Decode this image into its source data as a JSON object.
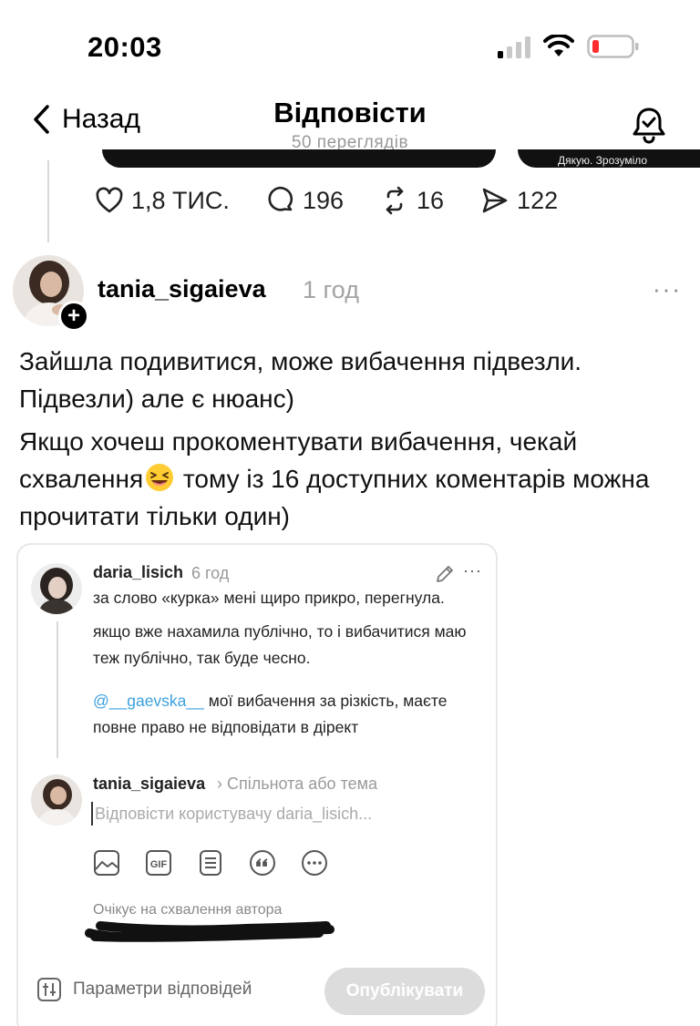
{
  "status_bar": {
    "time": "20:03"
  },
  "header": {
    "back_label": "Назад",
    "title": "Відповісти",
    "subtitle": "50 переглядів"
  },
  "previous_post": {
    "card_caption": "Дякую. Зрозуміло",
    "likes": "1,8 ТИС.",
    "comments": "196",
    "reposts": "16",
    "shares": "122"
  },
  "post": {
    "username": "tania_sigaieva",
    "time": "1 год",
    "more_label": "···",
    "follow_label": "+",
    "paragraph_1": "Зайшла подивитися, може вибачення підвезли. Підвезли) але є нюанс)",
    "paragraph_2_before": "Якщо хочеш прокоментувати вибачення, чекай схвалення",
    "paragraph_2_after": " тому із 16 доступних коментарів можна прочитати тільки один)",
    "emoji": "laughing-squinting-emoji"
  },
  "embedded_screenshot": {
    "comment": {
      "username": "daria_lisich",
      "time": "6 год",
      "more_label": "···",
      "line_1": "за слово «курка» мені щиро прикро, перегнула.",
      "line_2": "якщо вже нахамила публічно, то і вибачитися маю теж публічно, так буде чесно.",
      "mention": "@__gaevska__",
      "line_3_rest": " мої вибачення за різкість, маєте повне право не відповідати в дірект"
    },
    "reply": {
      "username": "tania_sigaieva",
      "community": "› Спільнота або тема",
      "placeholder": "Відповісти користувачу daria_lisich..."
    },
    "pending_text": "Очікує на схвалення автора",
    "params_label": "Параметри відповідей",
    "publish_label": "Опублікувати"
  },
  "icons": [
    "chevron-left-icon",
    "bell-check-icon",
    "heart-icon",
    "comment-icon",
    "repost-icon",
    "send-icon",
    "image-icon",
    "gif-icon",
    "list-icon",
    "quote-icon",
    "more-circle-icon",
    "pencil-icon",
    "sliders-icon"
  ],
  "colors": {
    "mention": "#3ba0dd",
    "muted": "#999999",
    "publish_disabled": "#dcdcdc"
  }
}
